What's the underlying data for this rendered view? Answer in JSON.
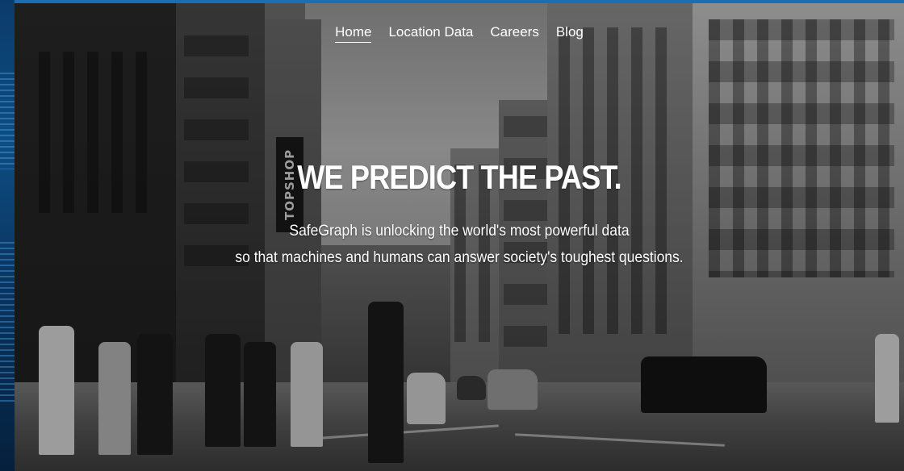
{
  "nav": {
    "items": [
      {
        "label": "Home",
        "active": true
      },
      {
        "label": "Location Data",
        "active": false
      },
      {
        "label": "Careers",
        "active": false
      },
      {
        "label": "Blog",
        "active": false
      }
    ]
  },
  "hero": {
    "headline": "WE PREDICT THE PAST.",
    "subline_1": "SafeGraph is unlocking the world's most powerful data",
    "subline_2": "so that machines and humans can answer society's toughest questions.",
    "storefront_sign": "TOPSHOP"
  },
  "colors": {
    "text": "#ffffff",
    "page_edge": "#0b3b6b",
    "top_strip": "#1a6fb4"
  }
}
